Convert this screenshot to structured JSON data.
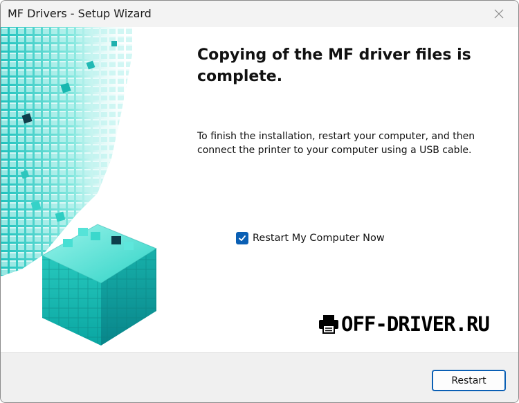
{
  "window": {
    "title": "MF Drivers - Setup Wizard",
    "close_icon": "close-icon"
  },
  "main": {
    "heading": "Copying of the MF driver files is complete.",
    "message": "To finish the installation, restart your computer, and then connect the printer to your computer using a USB cable.",
    "checkbox": {
      "label": "Restart My Computer Now",
      "checked": true
    },
    "art_icon": "cube-blocks-illustration"
  },
  "watermark": {
    "text": "OFF-DRIVER.RU",
    "icon": "printer-icon"
  },
  "footer": {
    "restart_label": "Restart"
  },
  "colors": {
    "accent": "#0a5fb4",
    "teal": "#2ed1c4",
    "teal_dark": "#0a8d8a",
    "footer_bg": "#f0f0f0",
    "titlebar_bg": "#f3f3f3"
  }
}
